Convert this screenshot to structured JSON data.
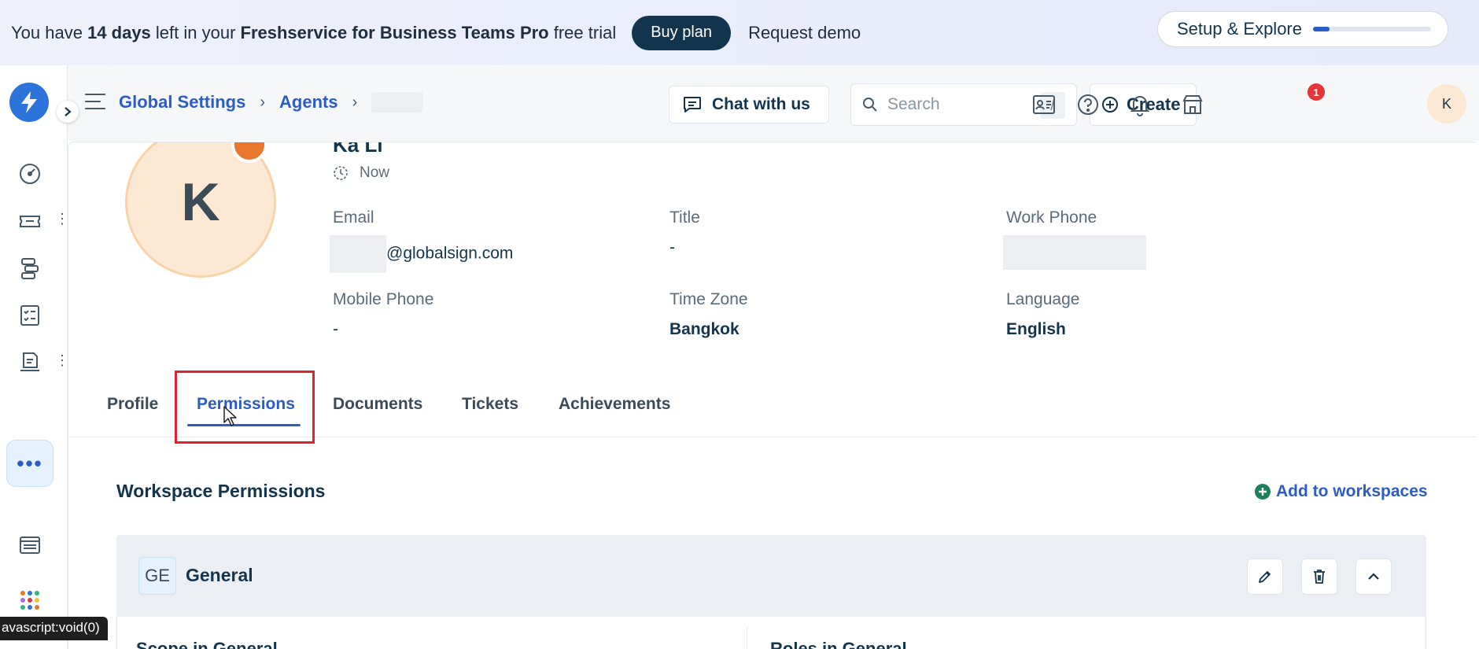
{
  "banner": {
    "prefix": "You have ",
    "days": "14 days",
    "middle": " left in your ",
    "plan_name": "Freshservice for Business Teams Pro",
    "suffix": " free trial",
    "buy_label": "Buy plan",
    "demo_label": "Request demo",
    "setup_label": "Setup & Explore",
    "setup_progress": 0.14
  },
  "breadcrumb": {
    "items": [
      "Global Settings",
      "Agents"
    ]
  },
  "header": {
    "chat_label": "Chat with us",
    "search_placeholder": "Search",
    "search_shortcut": "/",
    "create_label": "Create",
    "notification_count": "1",
    "avatar_initial": "K"
  },
  "profile": {
    "avatar_initial": "K",
    "name_partial": "Ka Li",
    "last_seen": "Now",
    "fields": {
      "email": {
        "label": "Email",
        "value": "@globalsign.com"
      },
      "title": {
        "label": "Title",
        "value": "-"
      },
      "work_phone": {
        "label": "Work Phone",
        "value": ""
      },
      "mobile_phone": {
        "label": "Mobile Phone",
        "value": "-"
      },
      "time_zone": {
        "label": "Time Zone",
        "value": "Bangkok"
      },
      "language": {
        "label": "Language",
        "value": "English"
      }
    }
  },
  "tabs": [
    "Profile",
    "Permissions",
    "Documents",
    "Tickets",
    "Achievements"
  ],
  "active_tab": "Permissions",
  "workspace": {
    "title": "Workspace Permissions",
    "add_label": "Add to workspaces",
    "panel": {
      "badge": "GE",
      "name": "General",
      "col1_partial": "Scope in General",
      "col2_partial": "Roles in General"
    }
  },
  "statusbar": {
    "text": "avascript:void(0)"
  },
  "colors": {
    "accent": "#2c5cc5",
    "dark": "#12344d",
    "highlight_red": "#e3212d",
    "avatar_bg": "#fde8d3"
  }
}
